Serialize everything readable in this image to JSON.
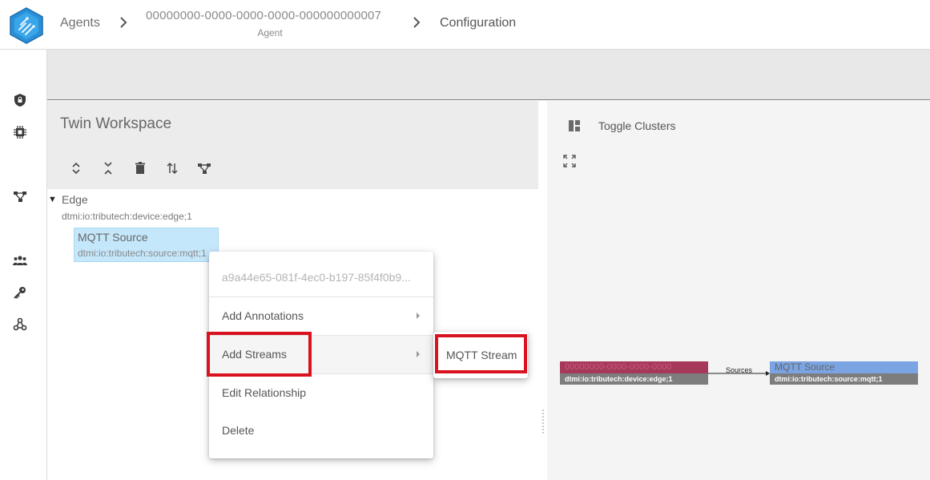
{
  "header": {
    "breadcrumbs": {
      "agents": "Agents",
      "agent_id": "00000000-0000-0000-0000-000000000007",
      "agent_id_caption": "Agent",
      "current": "Configuration"
    }
  },
  "rail": {
    "icons": [
      "shield-lock-icon",
      "chip-icon",
      "graph-nodes-icon",
      "users-icon",
      "key-icon",
      "webhook-icon"
    ]
  },
  "workspace": {
    "title": "Twin Workspace",
    "toolbar": [
      "expand-all-icon",
      "collapse-all-icon",
      "delete-icon",
      "sort-icon",
      "hierarchy-icon"
    ],
    "tree": {
      "root": {
        "label": "Edge",
        "model": "dtmi:io:tributech:device:edge;1"
      },
      "selected_child": {
        "label": "MQTT Source",
        "model": "dtmi:io:tributech:source:mqtt;1"
      }
    }
  },
  "context_menu": {
    "header_id": "a9a44e65-081f-4ec0-b197-85f4f0b9...",
    "items": [
      {
        "label": "Add Annotations",
        "has_submenu": true
      },
      {
        "label": "Add Streams",
        "has_submenu": true
      },
      {
        "label": "Edit Relationship",
        "has_submenu": false
      },
      {
        "label": "Delete",
        "has_submenu": false
      }
    ],
    "submenu": {
      "items": [
        "MQTT Stream"
      ]
    }
  },
  "graph_panel": {
    "toggle_clusters_label": "Toggle Clusters",
    "edge_node": {
      "title": "00000000-0000-0000-0000",
      "model": "dtmi:io:tributech:device:edge;1"
    },
    "relation_label": "Sources",
    "source_node": {
      "title": "MQTT Source",
      "model": "dtmi:io:tributech:source:mqtt;1"
    }
  },
  "colors": {
    "highlight": "#d8121f",
    "selected_node": "#c5e7fb",
    "edge_node": "#a6385a",
    "source_node": "#7ba4e3"
  }
}
